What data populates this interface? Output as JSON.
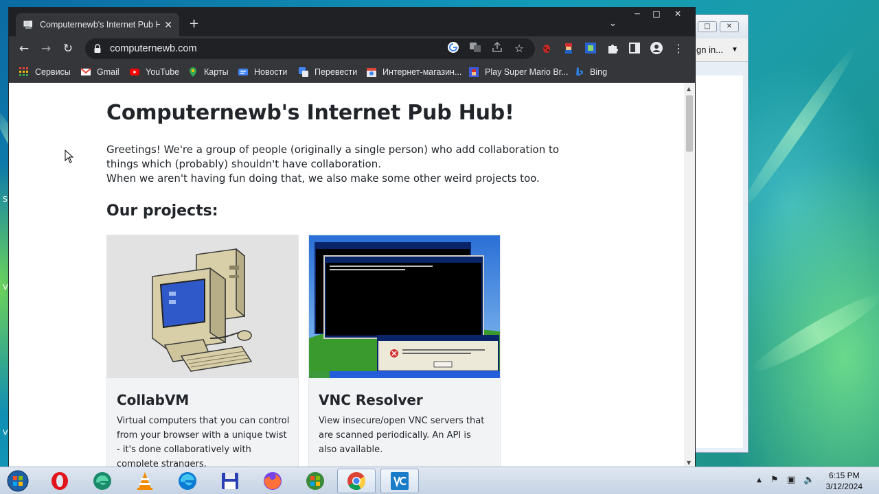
{
  "browser": {
    "tab_title": "Computernewb's Internet Pub Hub!",
    "tab_title_display": "Computernewb's Internet Pub Hu",
    "url": "computernewb.com",
    "bookmarks": [
      {
        "label": "Сервисы",
        "icon": "apps-grid-icon",
        "color": "#ea4335"
      },
      {
        "label": "Gmail",
        "icon": "gmail-icon",
        "color": "#ea4335"
      },
      {
        "label": "YouTube",
        "icon": "youtube-icon",
        "color": "#ff0000"
      },
      {
        "label": "Карты",
        "icon": "maps-icon",
        "color": "#34a853"
      },
      {
        "label": "Новости",
        "icon": "news-icon",
        "color": "#4285f4"
      },
      {
        "label": "Перевести",
        "icon": "translate-icon",
        "color": "#4285f4"
      },
      {
        "label": "Интернет-магазин...",
        "icon": "web-store-icon",
        "color": "#db4437"
      },
      {
        "label": "Play Super Mario Br...",
        "icon": "mario-icon",
        "color": "#3b5bdb"
      },
      {
        "label": "Bing",
        "icon": "bing-icon",
        "color": "#2f7cd7"
      }
    ]
  },
  "page": {
    "heading": "Computernewb's Internet Pub Hub!",
    "intro_line1": "Greetings! We're a group of people (originally a single person) who add collaboration to things which (probably) shouldn't have collaboration.",
    "intro_line2": "When we aren't having fun doing that, we also make some other weird projects too.",
    "projects_heading": "Our projects:",
    "projects": [
      {
        "title": "CollabVM",
        "description": "Virtual computers that you can control from your browser with a unique twist - it's done collaboratively with complete strangers.",
        "image": "retro-computer-illustration"
      },
      {
        "title": "VNC Resolver",
        "description": "View insecure/open VNC servers that are scanned periodically. An API is also available.",
        "image": "vnc-screenshot-windows-xp"
      }
    ]
  },
  "background_window": {
    "toolbar_text": "gn in..."
  },
  "taskbar": {
    "apps": [
      "start-orb-icon",
      "opera-icon",
      "edge-beta-icon",
      "vlc-icon",
      "edge-icon",
      "save-floppy-icon",
      "firefox-icon",
      "windows-icon",
      "chrome-icon",
      "vnc-icon"
    ],
    "time": "6:15 PM",
    "date": "3/12/2024"
  },
  "desktop": {
    "edge_letters": [
      "S",
      "V",
      "V"
    ]
  },
  "colors": {
    "chrome_dark": "#202124",
    "chrome_toolbar": "#35363a",
    "page_text": "#212529",
    "card_bg": "#f1f3f5"
  }
}
